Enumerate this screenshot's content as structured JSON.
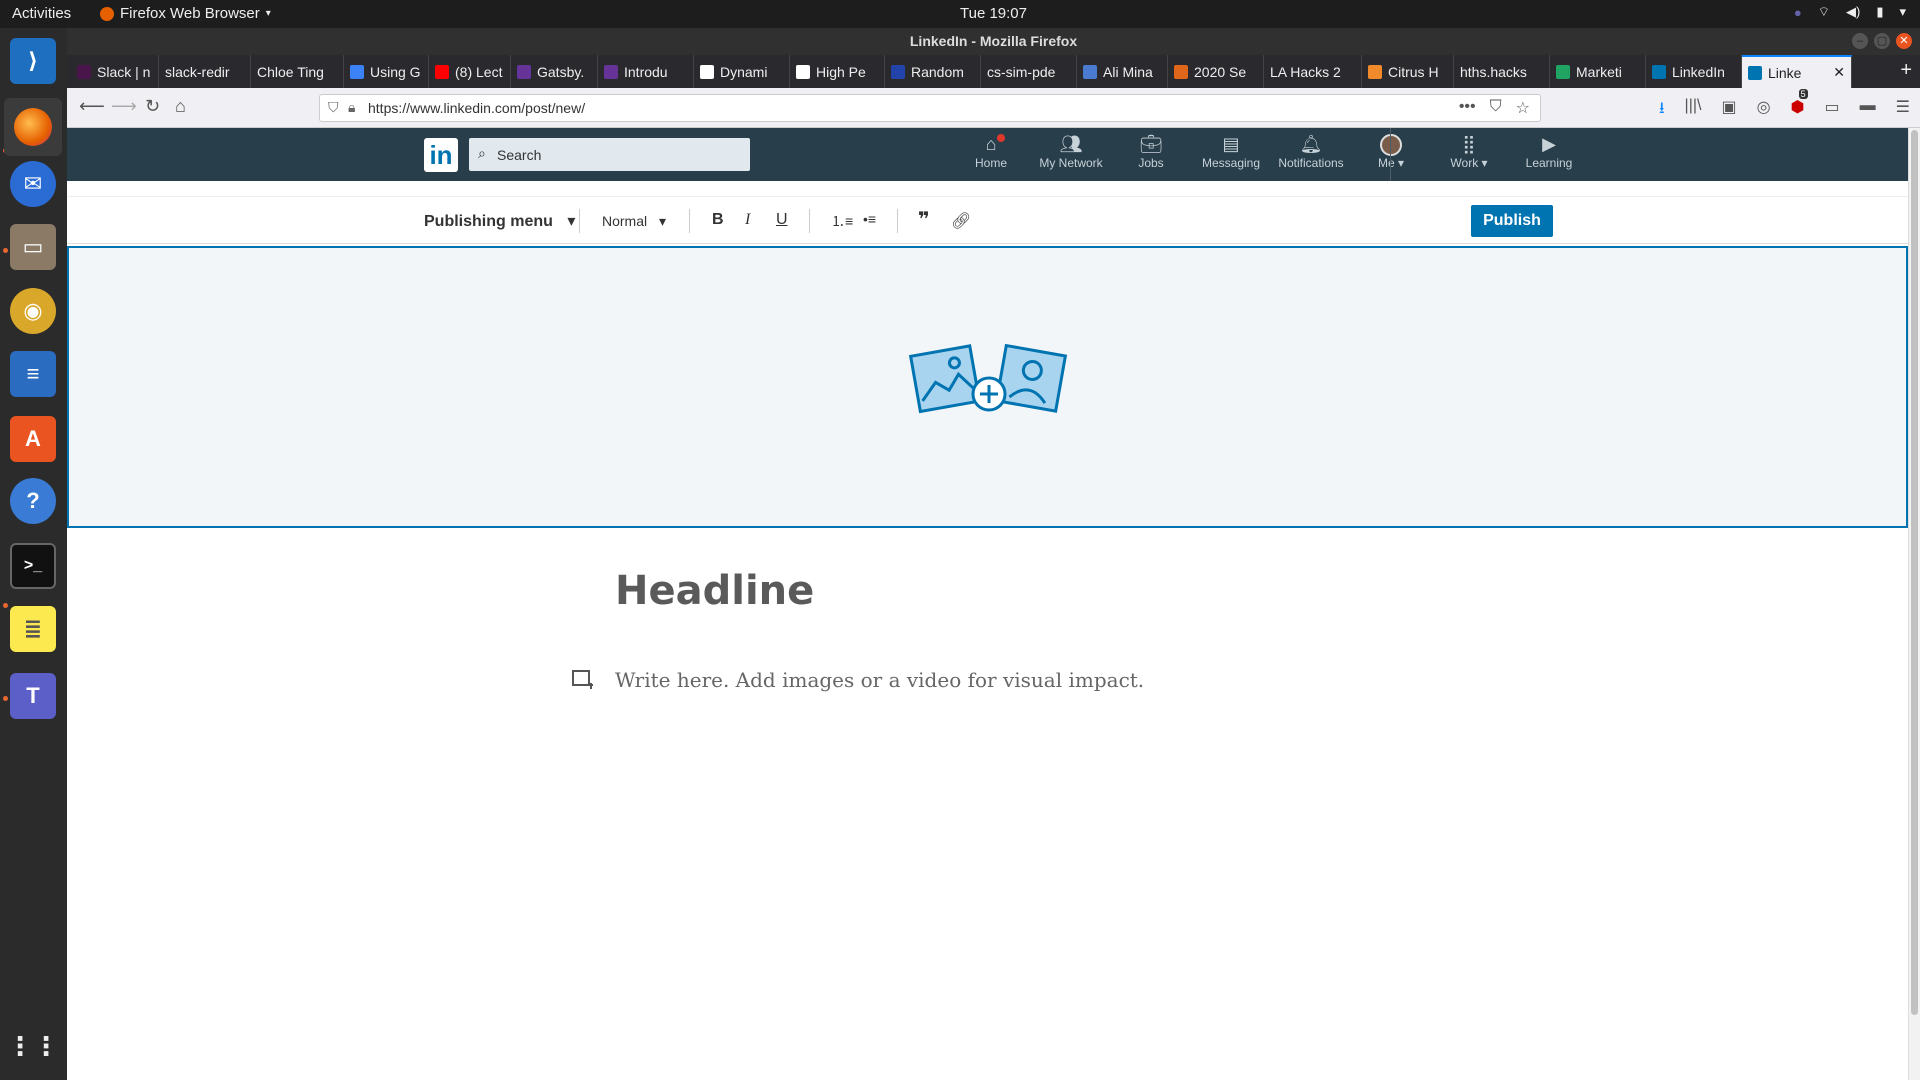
{
  "system": {
    "activities": "Activities",
    "app_name": "Firefox Web Browser",
    "clock": "Tue 19:07",
    "notification_count": "5"
  },
  "window": {
    "title": "LinkedIn - Mozilla Firefox"
  },
  "tabs": [
    {
      "label": "Slack | n",
      "color": "#4a154b"
    },
    {
      "label": "slack-redir",
      "color": ""
    },
    {
      "label": "Chloe Ting",
      "color": ""
    },
    {
      "label": "Using G",
      "color": "#3b82f6"
    },
    {
      "label": "(8) Lect",
      "color": "#ff0000"
    },
    {
      "label": "Gatsby.",
      "color": "#663399"
    },
    {
      "label": "Introdu",
      "color": "#663399"
    },
    {
      "label": "Dynami",
      "color": "#ffffff"
    },
    {
      "label": "High Pe",
      "color": "#ffffff"
    },
    {
      "label": "Random",
      "color": "#2244aa"
    },
    {
      "label": "cs-sim-pde",
      "color": ""
    },
    {
      "label": "Ali Mina",
      "color": "#4a7bd0"
    },
    {
      "label": "2020 Se",
      "color": "#e0661a"
    },
    {
      "label": "LA Hacks 2",
      "color": ""
    },
    {
      "label": "Citrus H",
      "color": "#f08a2a"
    },
    {
      "label": "hths.hacks",
      "color": ""
    },
    {
      "label": "Marketi",
      "color": "#1fa463"
    },
    {
      "label": "LinkedIn",
      "color": "#0073b1"
    },
    {
      "label": "Linke",
      "color": "#0073b1",
      "active": true
    }
  ],
  "urlbar": {
    "url": "https://www.linkedin.com/post/new/"
  },
  "linkedin": {
    "logo": "in",
    "search_placeholder": "Search",
    "nav": [
      {
        "label": "Home",
        "icon": "home-icon"
      },
      {
        "label": "My Network",
        "icon": "network-icon"
      },
      {
        "label": "Jobs",
        "icon": "briefcase-icon"
      },
      {
        "label": "Messaging",
        "icon": "messaging-icon"
      },
      {
        "label": "Notifications",
        "icon": "bell-icon"
      },
      {
        "label": "Me",
        "icon": "avatar"
      },
      {
        "label": "Work",
        "icon": "grid-icon"
      },
      {
        "label": "Learning",
        "icon": "play-icon"
      }
    ]
  },
  "editor": {
    "publishing_menu": "Publishing menu",
    "style_select": "Normal",
    "bold": "B",
    "italic": "I",
    "underline": "U",
    "publish": "Publish",
    "headline_placeholder": "Headline",
    "body_placeholder": "Write here. Add images or a video for visual impact."
  }
}
